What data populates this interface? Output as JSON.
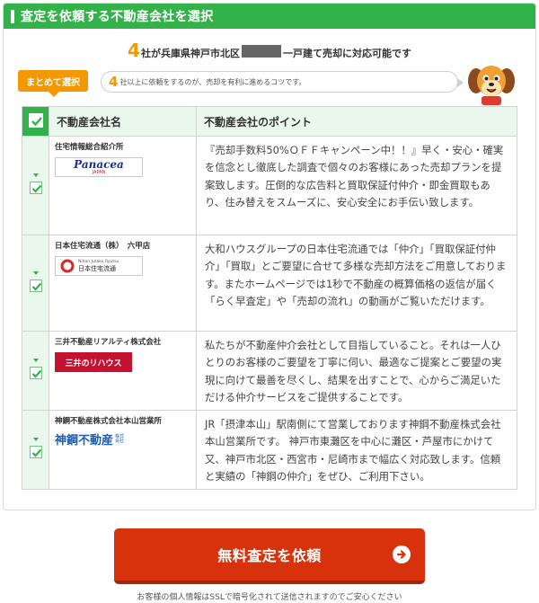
{
  "header": {
    "title": "査定を依頼する不動産会社を選択"
  },
  "lead": {
    "count": "4",
    "before": "社が兵庫県神戸市北区",
    "after": "一戸建て売却に対応可能です"
  },
  "bulk_select": {
    "label": "まとめて選択"
  },
  "tip": {
    "count": "4",
    "text": "社以上に依頼をするのが、売却を有利に進めるコツです。"
  },
  "table": {
    "col_name": "不動産会社名",
    "col_point": "不動産会社のポイント",
    "rows": [
      {
        "name": "住宅情報総合紹介所",
        "logo_text": "Panacea",
        "logo_sub": "JAPAN",
        "point": "『売却手数料50%ＯＦＦキャンペーン中！！』早く・安心・確実を信念とし徹底した調査で個々のお客様にあった売却プランを提案致します。圧倒的な広告料と買取保証付仲介・即金買取もあり、住み替えをスムーズに、安心安全にお手伝い致します。"
      },
      {
        "name": "日本住宅流通（株）　六甲店",
        "logo_text": "日本住宅流通",
        "logo_sub": "Nihon Jutaku Ryutsu",
        "point": "大和ハウスグループの日本住宅流通では「仲介」「買取保証付仲介」「買取」とご要望に合せて多様な売却方法をご用意しております。またホームページでは1秒で不動産の概算価格の返信が届く「らく早査定」や「売却の流れ」の動画がご覧いただけます。"
      },
      {
        "name": "三井不動産リアルティ株式会社",
        "logo_text": "三井のリハウス",
        "point": "私たちが不動産仲介会社として目指していること。それは一人ひとりのお客様のご要望を丁寧に伺い、最適なご提案とご要望の実現に向けて最善を尽くし、結果を出すことで、心からご満足いただける仲介サービスをご提供することです。"
      },
      {
        "name": "神鋼不動産株式会社本山営業所",
        "logo_text": "神鋼不動産",
        "logo_sub": "株式会社",
        "point": "JR「摂津本山」駅南側にて営業しております神鋼不動産株式会社本山営業所です。 神戸市東灘区を中心に灘区・芦屋市にかけて又、神戸市北区・西宮市・尼崎市まで幅広く対応致します。信頼と実績の「神鋼の仲介」をぜひ、ご利用下さい。"
      }
    ]
  },
  "cta": {
    "label": "無料査定を依頼"
  },
  "note": "お客様の個人情報はSSLで暗号化されて送信されますのでご安心ください",
  "colors": {
    "green": "#33b24a",
    "orange": "#f39800",
    "cta_red": "#d8320c"
  }
}
